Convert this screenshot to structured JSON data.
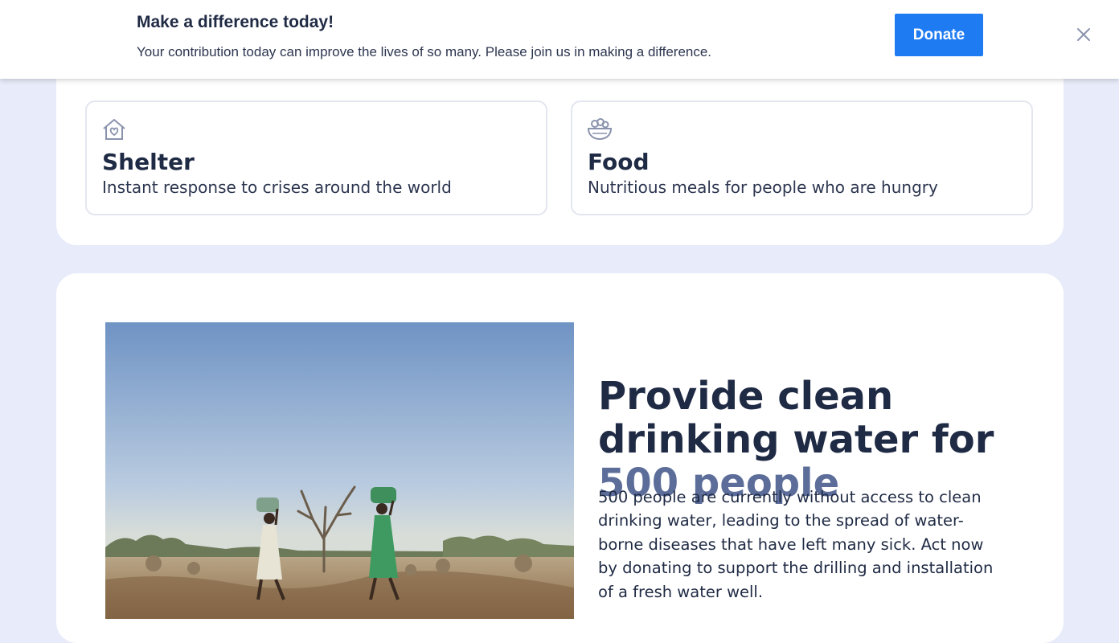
{
  "banner": {
    "title": "Make a difference today!",
    "text": "Your contribution today can improve the lives of so many. Please join us in making a difference.",
    "donate_label": "Donate",
    "close_icon": "close-icon"
  },
  "causes": [
    {
      "icon": "house-heart-icon",
      "title": "Shelter",
      "description": "Instant response to crises around the world"
    },
    {
      "icon": "food-bowl-icon",
      "title": "Food",
      "description": "Nutritious meals for people who are hungry"
    }
  ],
  "feature": {
    "image": "women-carrying-water-photo",
    "headline_part1": "Provide clean drinking water for",
    "headline_accent": "500 people",
    "body": "500 people are currently without access to clean drinking water, leading to the spread of water-borne diseases that have left many sick. Act now by donating to support the drilling and installation of a fresh water well."
  },
  "colors": {
    "background": "#e8ecfa",
    "accent_button": "#1f7bf2",
    "headline_accent": "#5c6d9a",
    "text": "#1f2a44"
  }
}
